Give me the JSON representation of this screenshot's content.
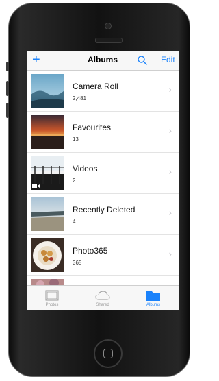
{
  "navbar": {
    "add_icon": "plus-icon",
    "title": "Albums",
    "search_icon": "search-icon",
    "edit_label": "Edit"
  },
  "albums": [
    {
      "title": "Camera Roll",
      "count": "2,481",
      "thumb": "sky-photo"
    },
    {
      "title": "Favourites",
      "count": "13",
      "thumb": "sunset-photo"
    },
    {
      "title": "Videos",
      "count": "2",
      "thumb": "video-photo"
    },
    {
      "title": "Recently Deleted",
      "count": "4",
      "thumb": "beach-photo"
    },
    {
      "title": "Photo365",
      "count": "365",
      "thumb": "food-plate-photo"
    }
  ],
  "tabbar": {
    "tabs": [
      {
        "label": "Photos",
        "icon": "photos-icon",
        "active": false
      },
      {
        "label": "Shared",
        "icon": "cloud-icon",
        "active": false
      },
      {
        "label": "Albums",
        "icon": "albums-folder-icon",
        "active": true
      }
    ]
  },
  "colors": {
    "accent": "#1a82fb",
    "chevron": "#c7c7cc"
  }
}
